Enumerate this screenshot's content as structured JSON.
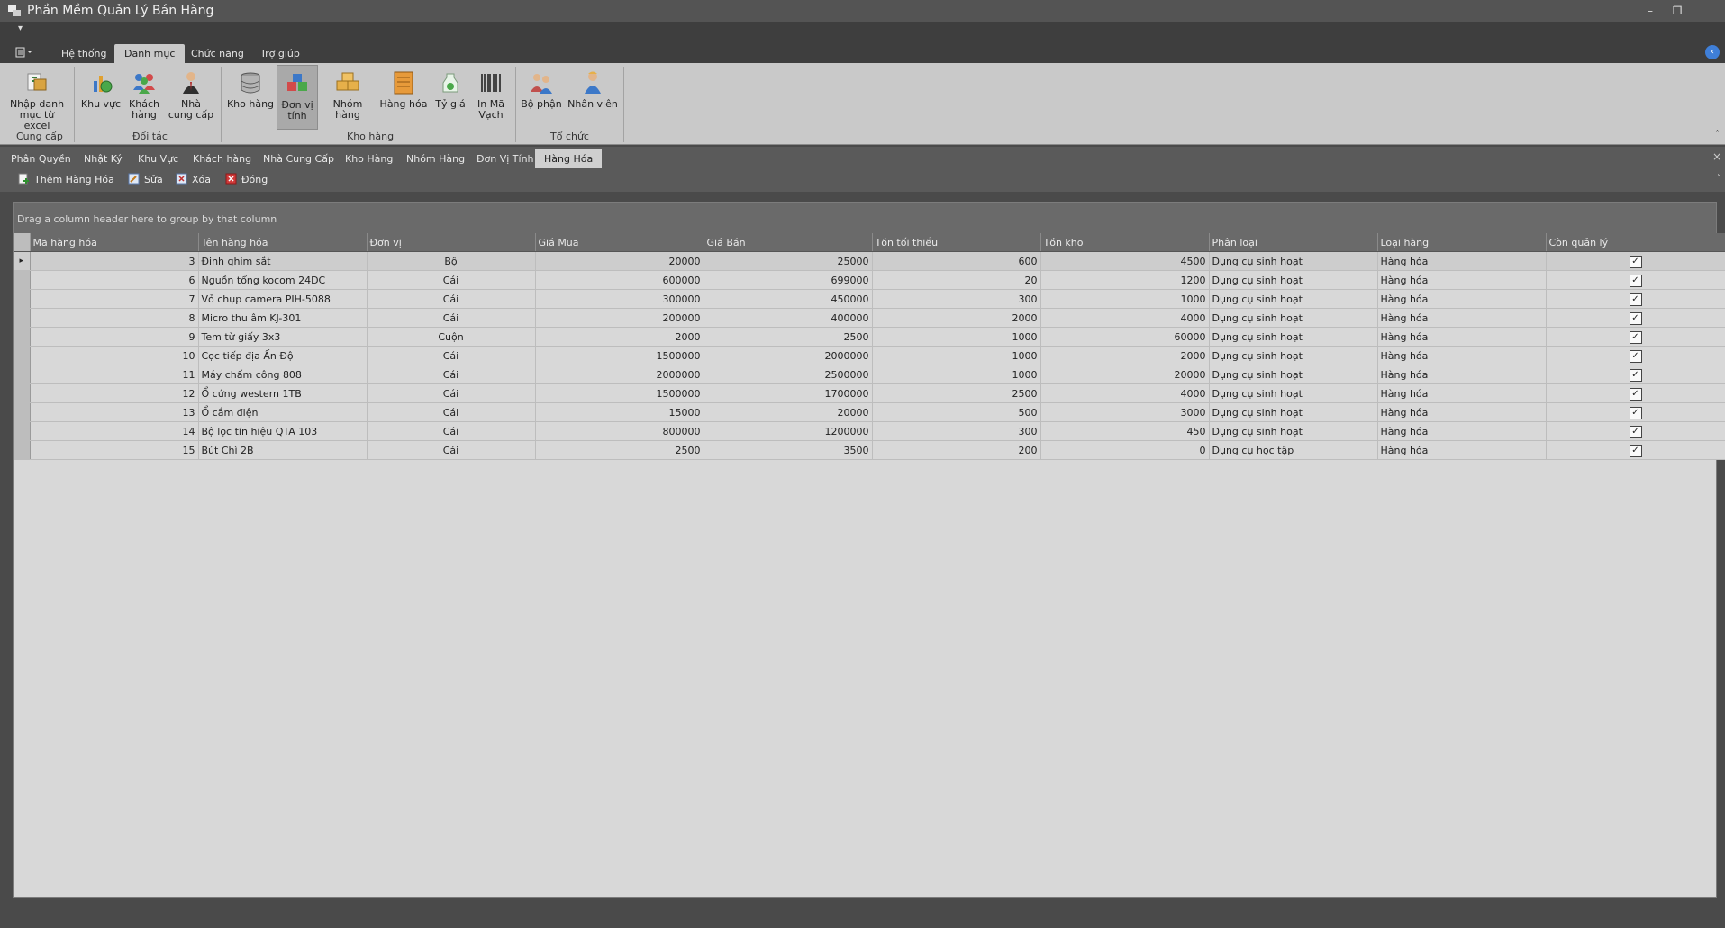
{
  "window": {
    "title": "Phần Mềm Quản Lý Bán Hàng",
    "minimize": "–",
    "restore": "❐",
    "quick_access": "▾"
  },
  "ribbon_tabs": [
    {
      "label": "Hệ thống"
    },
    {
      "label": "Danh mục",
      "active": true
    },
    {
      "label": "Chức năng"
    },
    {
      "label": "Trợ giúp"
    }
  ],
  "ribbon": {
    "buttons": [
      {
        "label": "Nhập danh mục từ excel",
        "icon": "excel-import-icon"
      },
      {
        "label": "Khu vực",
        "icon": "region-chart-icon"
      },
      {
        "label": "Khách hàng",
        "icon": "customers-icon"
      },
      {
        "label": "Nhà cung cấp",
        "icon": "supplier-icon"
      },
      {
        "label": "Kho hàng",
        "icon": "warehouse-db-icon"
      },
      {
        "label": "Đơn vị tính",
        "icon": "unit-icon",
        "selected": true
      },
      {
        "label": "Nhóm hàng",
        "icon": "product-group-icon"
      },
      {
        "label": "Hàng hóa",
        "icon": "goods-box-icon"
      },
      {
        "label": "Tỷ giá",
        "icon": "exchange-rate-icon"
      },
      {
        "label": "In Mã Vạch",
        "icon": "barcode-icon"
      },
      {
        "label": "Bộ phận",
        "icon": "department-icon"
      },
      {
        "label": "Nhân viên",
        "icon": "employee-icon"
      }
    ],
    "groups": [
      {
        "label": "Cung cấp"
      },
      {
        "label": "Đối tác"
      },
      {
        "label": "Kho hàng"
      },
      {
        "label": "Tổ chức"
      }
    ],
    "collapse": "˄"
  },
  "doc_tabs": [
    {
      "label": "Phân Quyền"
    },
    {
      "label": "Nhật Ký"
    },
    {
      "label": "Khu Vực"
    },
    {
      "label": "Khách hàng"
    },
    {
      "label": "Nhà Cung Cấp"
    },
    {
      "label": "Kho Hàng"
    },
    {
      "label": "Nhóm Hàng"
    },
    {
      "label": "Đơn Vị Tính"
    },
    {
      "label": "Hàng Hóa",
      "active": true
    }
  ],
  "doc_close": "×",
  "toolbar": {
    "add_label": "Thêm Hàng Hóa",
    "edit_label": "Sửa",
    "delete_label": "Xóa",
    "close_label": "Đóng",
    "expand": "˅"
  },
  "grid": {
    "group_prompt": "Drag a column header here to group by that column",
    "columns": [
      "Mã hàng hóa",
      "Tên hàng hóa",
      "Đơn vị",
      "Giá Mua",
      "Giá Bán",
      "Tồn tối thiểu",
      "Tồn kho",
      "Phân loại",
      "Loại hàng",
      "Còn quản lý"
    ],
    "rows": [
      [
        "3",
        "Đinh ghim sắt",
        "Bộ",
        "20000",
        "25000",
        "600",
        "4500",
        "Dụng cụ sinh hoạt",
        "Hàng hóa",
        true
      ],
      [
        "6",
        "Nguồn tổng kocom 24DC",
        "Cái",
        "600000",
        "699000",
        "20",
        "1200",
        "Dụng cụ sinh hoạt",
        "Hàng hóa",
        true
      ],
      [
        "7",
        "Vỏ chụp camera PIH-5088",
        "Cái",
        "300000",
        "450000",
        "300",
        "1000",
        "Dụng cụ sinh hoạt",
        "Hàng hóa",
        true
      ],
      [
        "8",
        "Micro thu âm KJ-301",
        "Cái",
        "200000",
        "400000",
        "2000",
        "4000",
        "Dụng cụ sinh hoạt",
        "Hàng hóa",
        true
      ],
      [
        "9",
        "Tem từ giấy 3x3",
        "Cuộn",
        "2000",
        "2500",
        "1000",
        "60000",
        "Dụng cụ sinh hoạt",
        "Hàng hóa",
        true
      ],
      [
        "10",
        "Cọc tiếp địa Ấn Độ",
        "Cái",
        "1500000",
        "2000000",
        "1000",
        "2000",
        "Dụng cụ sinh hoạt",
        "Hàng hóa",
        true
      ],
      [
        "11",
        "Máy chấm công 808",
        "Cái",
        "2000000",
        "2500000",
        "1000",
        "20000",
        "Dụng cụ sinh hoạt",
        "Hàng hóa",
        true
      ],
      [
        "12",
        "Ổ cứng western 1TB",
        "Cái",
        "1500000",
        "1700000",
        "2500",
        "4000",
        "Dụng cụ sinh hoạt",
        "Hàng hóa",
        true
      ],
      [
        "13",
        "Ổ cắm điện",
        "Cái",
        "15000",
        "20000",
        "500",
        "3000",
        "Dụng cụ sinh hoạt",
        "Hàng hóa",
        true
      ],
      [
        "14",
        "Bộ lọc tín hiệu QTA 103",
        "Cái",
        "800000",
        "1200000",
        "300",
        "450",
        "Dụng cụ sinh hoạt",
        "Hàng hóa",
        true
      ],
      [
        "15",
        "Bút Chì 2B",
        "Cái",
        "2500",
        "3500",
        "200",
        "0",
        "Dụng cụ học tập",
        "Hàng hóa",
        true
      ]
    ]
  }
}
